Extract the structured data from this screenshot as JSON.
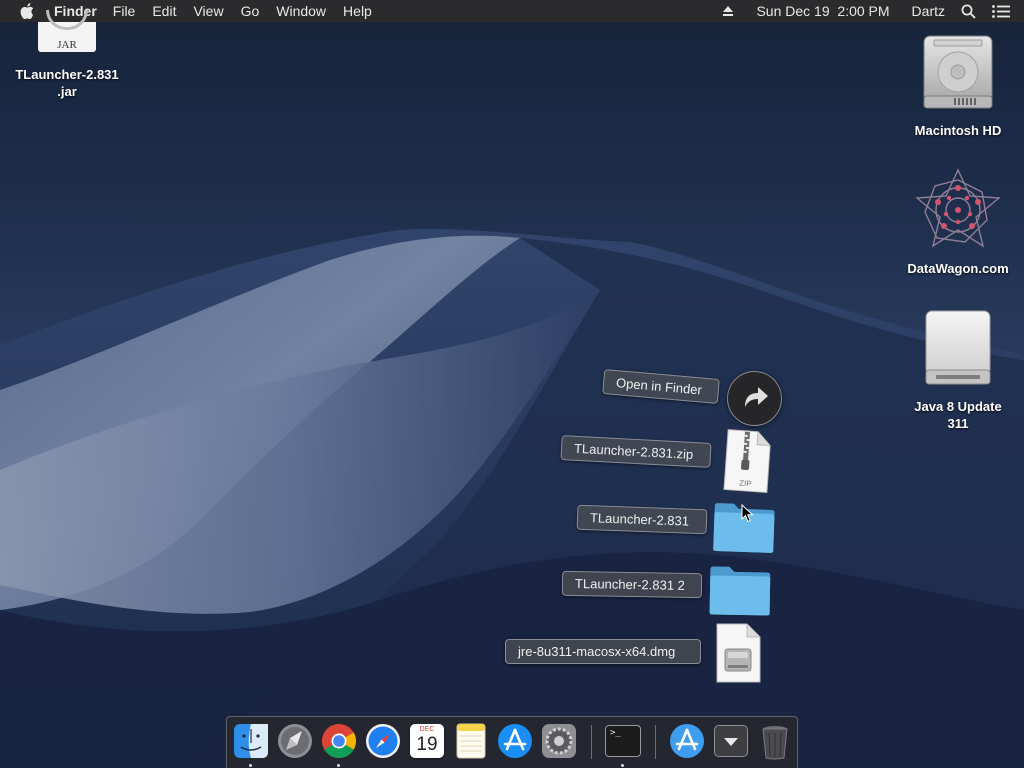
{
  "menubar": {
    "app_name": "Finder",
    "menus": [
      "File",
      "Edit",
      "View",
      "Go",
      "Window",
      "Help"
    ],
    "clock": "Sun Dec 19  2:00 PM",
    "user": "Dartz"
  },
  "desktop": {
    "icons": [
      {
        "name": "TLauncher-2.831 .jar",
        "line1": "TLauncher-2.831",
        "line2": ".jar",
        "badge": "JAR"
      },
      {
        "name": "Macintosh HD",
        "line1": "Macintosh HD"
      },
      {
        "name": "DataWagon.com",
        "line1": "DataWagon.com"
      },
      {
        "name": "Java 8 Update 311",
        "line1": "Java 8 Update",
        "line2": "311"
      }
    ]
  },
  "stack": {
    "open_in_finder": "Open in Finder",
    "items": [
      {
        "label": "TLauncher-2.831.zip",
        "kind": "zip-archive-icon",
        "badge": "ZIP"
      },
      {
        "label": "TLauncher-2.831",
        "kind": "folder-icon"
      },
      {
        "label": "TLauncher-2.831 2",
        "kind": "folder-icon"
      },
      {
        "label": "jre-8u311-macosx-x64.dmg",
        "kind": "disk-image-icon"
      }
    ]
  },
  "dock": {
    "apps": [
      "Finder",
      "Launchpad",
      "Google Chrome",
      "Safari",
      "Calendar",
      "Notes",
      "App Store",
      "System Preferences",
      "Terminal",
      "Applications",
      "Downloads",
      "Trash"
    ],
    "calendar_month": "DEC",
    "calendar_day": "19",
    "terminal_prompt": ">_"
  },
  "colors": {
    "menubar_bg": "#2b2b2d",
    "folder_blue": "#5fb2e6",
    "dock_bg": "#2a2a2e"
  }
}
